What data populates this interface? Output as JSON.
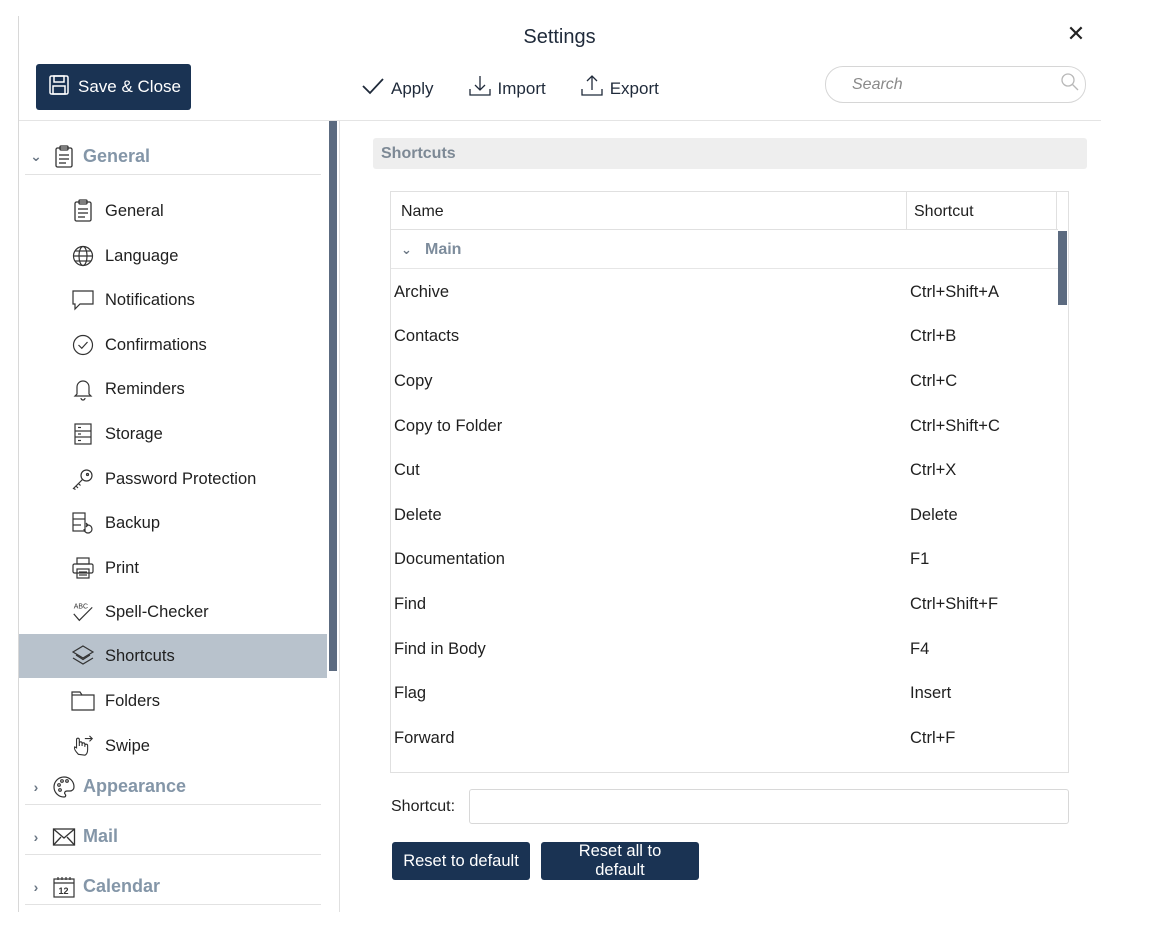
{
  "window": {
    "title": "Settings"
  },
  "toolbar": {
    "save_close_label": "Save & Close",
    "apply_label": "Apply",
    "import_label": "Import",
    "export_label": "Export",
    "search_placeholder": "Search"
  },
  "sidebar": {
    "groups": [
      {
        "label": "General",
        "expanded": true,
        "icon": "clipboard-icon"
      },
      {
        "label": "Appearance",
        "expanded": false,
        "icon": "palette-icon"
      },
      {
        "label": "Mail",
        "expanded": false,
        "icon": "envelope-icon"
      },
      {
        "label": "Calendar",
        "expanded": false,
        "icon": "calendar-icon",
        "icon_text": "12"
      }
    ],
    "items": [
      {
        "label": "General",
        "icon": "clipboard-icon"
      },
      {
        "label": "Language",
        "icon": "globe-icon"
      },
      {
        "label": "Notifications",
        "icon": "speech-bubble-icon"
      },
      {
        "label": "Confirmations",
        "icon": "check-circle-icon"
      },
      {
        "label": "Reminders",
        "icon": "bell-icon"
      },
      {
        "label": "Storage",
        "icon": "storage-icon"
      },
      {
        "label": "Password Protection",
        "icon": "key-icon"
      },
      {
        "label": "Backup",
        "icon": "backup-icon"
      },
      {
        "label": "Print",
        "icon": "printer-icon"
      },
      {
        "label": "Spell-Checker",
        "icon": "spell-check-icon",
        "icon_text": "ABC"
      },
      {
        "label": "Shortcuts",
        "icon": "shortcuts-icon",
        "selected": true
      },
      {
        "label": "Folders",
        "icon": "folder-icon"
      },
      {
        "label": "Swipe",
        "icon": "swipe-hand-icon"
      }
    ]
  },
  "main": {
    "section_title": "Shortcuts",
    "table": {
      "col_name": "Name",
      "col_shortcut": "Shortcut",
      "group_label": "Main",
      "rows": [
        {
          "name": "Archive",
          "shortcut": "Ctrl+Shift+A"
        },
        {
          "name": "Contacts",
          "shortcut": "Ctrl+B"
        },
        {
          "name": "Copy",
          "shortcut": "Ctrl+C"
        },
        {
          "name": "Copy to Folder",
          "shortcut": "Ctrl+Shift+C"
        },
        {
          "name": "Cut",
          "shortcut": "Ctrl+X"
        },
        {
          "name": "Delete",
          "shortcut": "Delete"
        },
        {
          "name": "Documentation",
          "shortcut": "F1"
        },
        {
          "name": "Find",
          "shortcut": "Ctrl+Shift+F"
        },
        {
          "name": "Find in Body",
          "shortcut": "F4"
        },
        {
          "name": "Flag",
          "shortcut": "Insert"
        },
        {
          "name": "Forward",
          "shortcut": "Ctrl+F"
        }
      ]
    },
    "shortcut_label": "Shortcut:",
    "shortcut_value": "",
    "reset_label": "Reset to default",
    "reset_all_label": "Reset all to default"
  },
  "colors": {
    "primary": "#1a3353",
    "selected_bg": "#b8c2cc",
    "group_text": "#8496a8",
    "scrollbar": "#5c6b80"
  }
}
